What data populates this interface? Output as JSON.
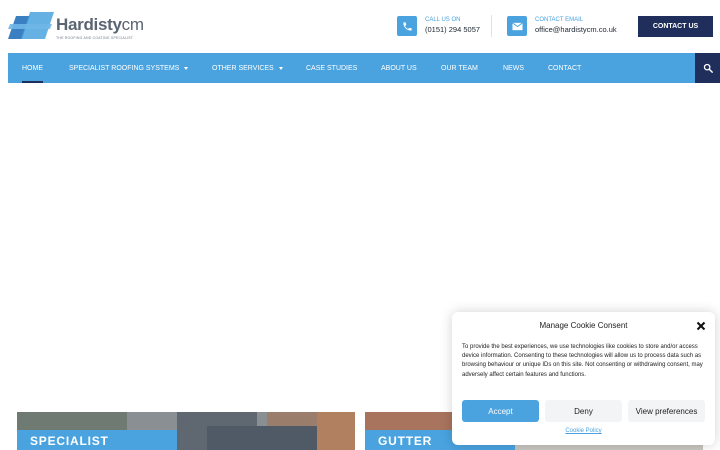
{
  "brand": {
    "name": "Hardisty",
    "suffix": "cm",
    "tagline": "THE ROOFING AND COATING SPECIALIST",
    "colors": {
      "accent": "#4aa3df",
      "navy": "#1f2e5b"
    }
  },
  "header": {
    "phone": {
      "icon": "phone-icon",
      "label": "CALL US ON",
      "value": "(0151) 294 5057"
    },
    "email": {
      "icon": "mail-icon",
      "label": "CONTACT EMAIL",
      "value": "office@hardistycm.co.uk"
    },
    "cta_label": "CONTACT US"
  },
  "nav": {
    "items": [
      {
        "label": "HOME",
        "active": true
      },
      {
        "label": "SPECIALIST ROOFING SYSTEMS",
        "dropdown": true
      },
      {
        "label": "OTHER SERVICES",
        "dropdown": true
      },
      {
        "label": "CASE STUDIES"
      },
      {
        "label": "ABOUT US"
      },
      {
        "label": "OUR TEAM"
      },
      {
        "label": "NEWS"
      },
      {
        "label": "CONTACT"
      }
    ],
    "search_icon": "search-icon"
  },
  "cards": [
    {
      "label": "SPECIALIST"
    },
    {
      "label": "GUTTER"
    }
  ],
  "cookie": {
    "title": "Manage Cookie Consent",
    "close_icon": "close-icon",
    "body": "To provide the best experiences, we use technologies like cookies to store and/or access device information. Consenting to these technologies will allow us to process data such as browsing behaviour or unique IDs on this site. Not consenting or withdrawing consent, may adversely affect certain features and functions.",
    "accept_label": "Accept",
    "deny_label": "Deny",
    "preferences_label": "View preferences",
    "policy_label": "Cookie Policy"
  }
}
